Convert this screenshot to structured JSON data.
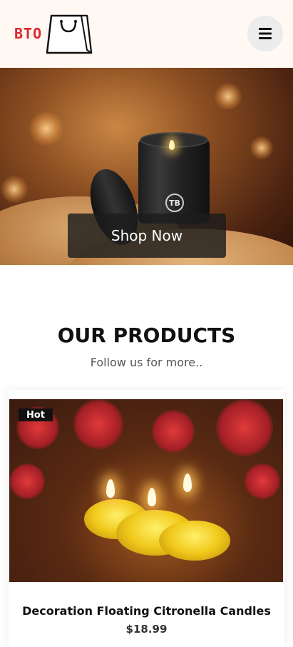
{
  "header": {
    "logo_text": "BTO",
    "menu_icon": "hamburger-icon"
  },
  "hero": {
    "button_label": "Shop Now",
    "jar_logo": "TB"
  },
  "products_section": {
    "title": "OUR PRODUCTS",
    "subtitle": "Follow us for more.."
  },
  "products": [
    {
      "badge": "Hot",
      "name": "Decoration Floating Citronella Candles",
      "price": "$18.99"
    }
  ],
  "colors": {
    "logo_red": "#e0262e",
    "header_bg": "#fff8f3",
    "button_dark": "#1c1c1c"
  }
}
